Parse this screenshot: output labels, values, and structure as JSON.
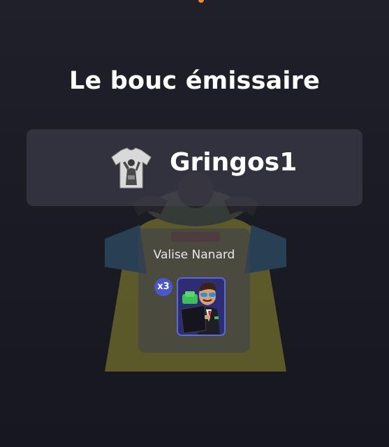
{
  "header": {
    "title": "Le bouc émissaire"
  },
  "player": {
    "name": "Gringos1",
    "avatar_icon": "jersey-avatar-icon"
  },
  "item": {
    "name": "Valise Nanard",
    "count": "x3",
    "icon": "suitcase-character-icon"
  },
  "colors": {
    "accent_orange": "#f08a2c",
    "badge_blue": "#4b56c8",
    "card_border_blue": "#5b6bd6"
  }
}
